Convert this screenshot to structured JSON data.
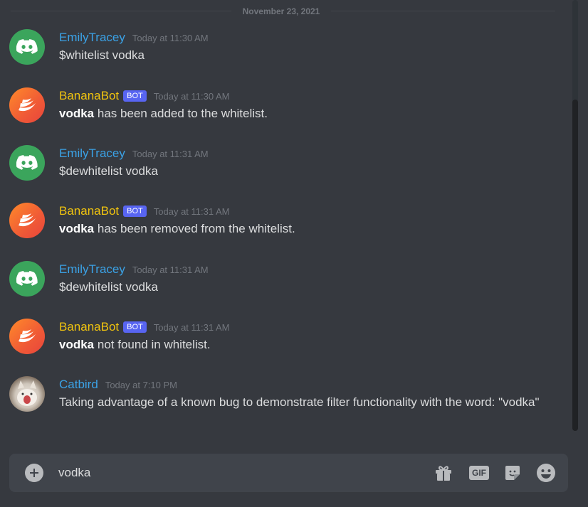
{
  "divider": {
    "date": "November 23, 2021"
  },
  "messages": [
    {
      "user": "EmilyTracey",
      "time": "Today at 11:30 AM",
      "text": "$whitelist vodka"
    },
    {
      "user": "BananaBot",
      "badge": "BOT",
      "time": "Today at 11:30 AM",
      "bold": "vodka",
      "text": " has been added to the whitelist."
    },
    {
      "user": "EmilyTracey",
      "time": "Today at 11:31 AM",
      "text": "$dewhitelist vodka"
    },
    {
      "user": "BananaBot",
      "badge": "BOT",
      "time": "Today at 11:31 AM",
      "bold": "vodka",
      "text": " has been removed from the whitelist."
    },
    {
      "user": "EmilyTracey",
      "time": "Today at 11:31 AM",
      "text": "$dewhitelist vodka"
    },
    {
      "user": "BananaBot",
      "badge": "BOT",
      "time": "Today at 11:31 AM",
      "bold": "vodka",
      "text": " not found in whitelist."
    },
    {
      "user": "Catbird",
      "time": "Today at 7:10 PM",
      "text": "Taking advantage of a known bug to demonstrate filter functionality with the word: \"vodka\""
    }
  ],
  "composer": {
    "value": "vodka",
    "icons": [
      "add-attachment-icon",
      "gift-icon",
      "gif-icon",
      "sticker-icon",
      "emoji-icon"
    ],
    "gif_label": "GIF"
  },
  "colors": {
    "background": "#36393f",
    "input": "#40444b",
    "link_user": "#3ba2e6",
    "bot_user": "#f1c40f",
    "bot_badge": "#5865f2"
  }
}
